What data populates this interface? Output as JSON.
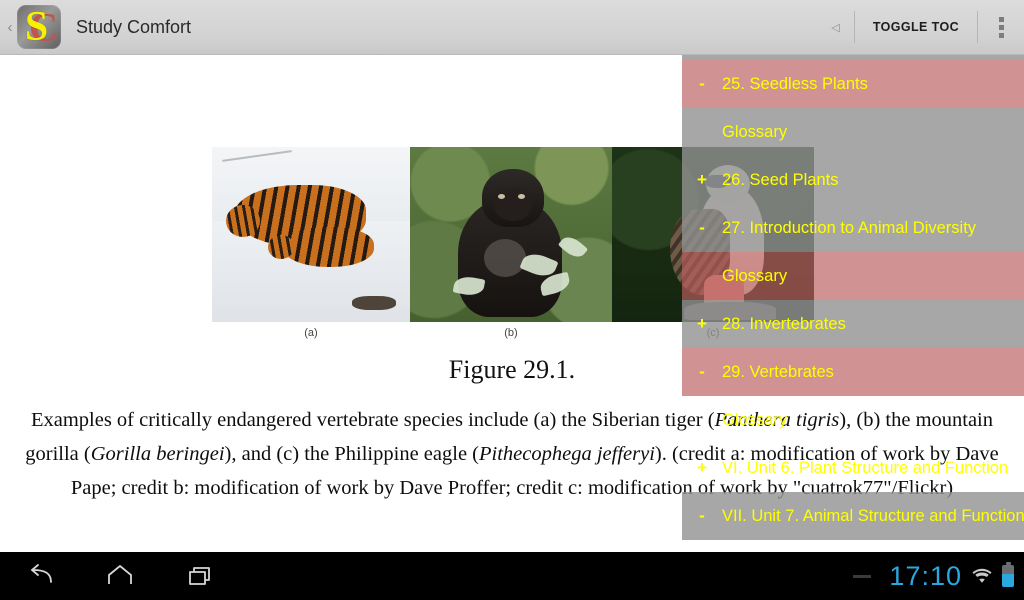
{
  "actionbar": {
    "up_glyph": "‹",
    "app_icon_back_letter": "C",
    "app_icon_front_letter": "S",
    "title": "Study Comfort",
    "collapse_caret": "◁",
    "toggle_toc_label": "TOGGLE TOC",
    "overflow_name": "overflow-menu"
  },
  "page": {
    "figure_title": "Figure 29.1.",
    "sub_labels": [
      "(a)",
      "(b)",
      "(c)"
    ],
    "caption_parts": {
      "p1": "Examples of critically endangered vertebrate species include (a) the Siberian tiger (",
      "i1": "Panthera tigris",
      "p2": "), (b) the mountain gorilla (",
      "i2": "Gorilla beringei",
      "p3": "), and (c) the Philippine eagle (",
      "i3": "Pithecophega jefferyi",
      "p4": "). (credit a: modification of work by Dave Pape; credit b: modification of work by Dave Proffer; credit c: modification of work by \"cuatrok77\"/Flickr)"
    },
    "images": [
      {
        "id": "image-a",
        "alt": "Siberian tiger with cub in snow"
      },
      {
        "id": "image-b",
        "alt": "Mountain gorilla sitting in vegetation"
      },
      {
        "id": "image-c",
        "alt": "Philippine eagle perched on a rock"
      }
    ]
  },
  "toc": {
    "rows": [
      {
        "toggle": "-",
        "label": "25. Seedless Plants",
        "state": "active"
      },
      {
        "toggle": "",
        "label": "Glossary",
        "state": "shaded"
      },
      {
        "toggle": "+",
        "label": "26. Seed Plants",
        "state": "shaded"
      },
      {
        "toggle": "-",
        "label": "27. Introduction to Animal Diversity",
        "state": "shaded"
      },
      {
        "toggle": "",
        "label": "Glossary",
        "state": "active"
      },
      {
        "toggle": "+",
        "label": "28. Invertebrates",
        "state": "shaded"
      },
      {
        "toggle": "-",
        "label": "29. Vertebrates",
        "state": "active"
      },
      {
        "toggle": "",
        "label": "Glossary",
        "state": "clear"
      },
      {
        "toggle": "+",
        "label": "VI. Unit 6. Plant Structure and Function",
        "state": "clear"
      },
      {
        "toggle": "-",
        "label": "VII. Unit 7. Animal Structure and Function",
        "state": "shaded"
      }
    ],
    "colors": {
      "text": "#ffff00",
      "row_shaded": "#919191",
      "row_active": "#b56f6f"
    }
  },
  "navbar": {
    "back_label": "back",
    "home_label": "home",
    "recents_label": "recent apps",
    "clock": "17:10",
    "wifi_label": "wifi",
    "battery_label": "battery"
  }
}
